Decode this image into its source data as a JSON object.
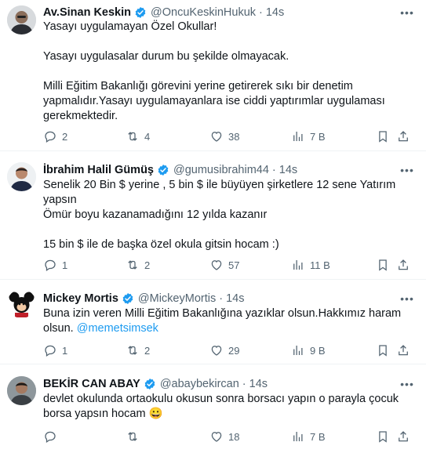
{
  "tweets": [
    {
      "name": "Av.Sinan Keskin",
      "handle": "@OncuKeskinHukuk",
      "time": "14s",
      "dot": "·",
      "lines": [
        "Yasayı uygulamayan Özel Okullar!",
        "",
        "Yasayı uygulasalar durum bu şekilde olmayacak.",
        "",
        "Milli Eğitim Bakanlığı görevini yerine getirerek sıkı bir denetim",
        "yapmalıdır.Yasayı uygulamayanlara ise ciddi yaptırımlar uygulaması",
        "gerekmektedir."
      ],
      "replies": "2",
      "retweets": "4",
      "likes": "38",
      "views": "7 B"
    },
    {
      "name": "İbrahim Halil Gümüş",
      "handle": "@gumusibrahim44",
      "time": "14s",
      "dot": "·",
      "lines": [
        "Senelik 20 Bin $ yerine , 5 bin $ ile büyüyen şirketlere 12 sene Yatırım",
        "yapsın",
        "Ömür boyu kazanamadığını 12 yılda kazanır",
        "",
        "15 bin $ ile de başka özel okula gitsin hocam :)"
      ],
      "replies": "1",
      "retweets": "2",
      "likes": "57",
      "views": "11 B"
    },
    {
      "name": "Mickey Mortis",
      "handle": "@MickeyMortis",
      "time": "14s",
      "dot": "·",
      "line1": "Buna izin veren Milli Eğitim Bakanlığına yazıklar olsun.Hakkımız haram",
      "line2_prefix": "olsun. ",
      "mention": "@memetsimsek",
      "replies": "1",
      "retweets": "2",
      "likes": "29",
      "views": "9 B"
    },
    {
      "name": "BEKİR CAN ABAY",
      "handle": "@abaybekircan",
      "time": "14s",
      "dot": "·",
      "lines": [
        "devlet okulunda ortaokulu okusun  sonra borsacı yapın o parayla çocuk",
        "borsa yapsın hocam 😀"
      ],
      "likes": "18",
      "views": "7 B"
    }
  ],
  "icons": {
    "reply": "reply-icon",
    "retweet": "retweet-icon",
    "like": "heart-icon",
    "views": "views-icon",
    "bookmark": "bookmark-icon",
    "share": "share-icon",
    "more": "more-icon",
    "verified": "verified-badge-icon"
  },
  "colors": {
    "verified": "#1d9bf0",
    "link": "#1d9bf0",
    "muted": "#536471",
    "text": "#0f1419"
  }
}
